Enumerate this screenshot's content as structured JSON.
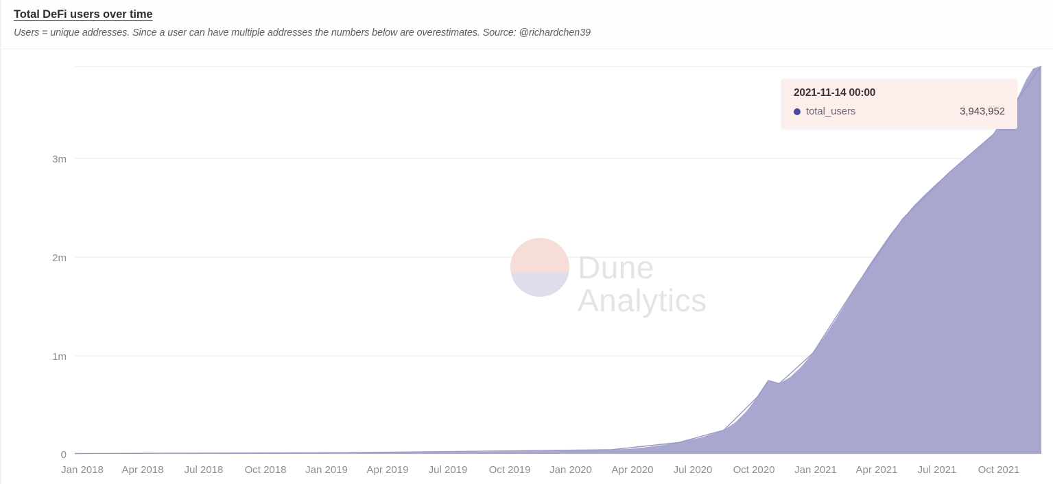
{
  "header": {
    "title": "Total DeFi users over time",
    "subtitle": "Users = unique addresses. Since a user can have multiple addresses the numbers below are overestimates. Source: @richardchen39"
  },
  "tooltip": {
    "date": "2021-11-14 00:00",
    "series_name": "total_users",
    "value": "3,943,952",
    "dot_color": "#4b4b9e",
    "background": "#fbeeeb"
  },
  "watermark": {
    "line1": "Dune",
    "line2": "Analytics"
  },
  "chart_data": {
    "type": "area",
    "title": "Total DeFi users over time",
    "subtitle": "Users = unique addresses. Since a user can have multiple addresses the numbers below are overestimates. Source: @richardchen39",
    "xlabel": "",
    "ylabel": "",
    "series_name": "total_users",
    "fill_color": "#a8a7cf",
    "grid": true,
    "legend": "none",
    "ylim": [
      0,
      4200000
    ],
    "ytick_labels": [
      "0",
      "1m",
      "2m",
      "3m"
    ],
    "ytick_values": [
      0,
      1000000,
      2000000,
      3000000
    ],
    "xtick_labels": [
      "Jan 2018",
      "Apr 2018",
      "Jul 2018",
      "Oct 2018",
      "Jan 2019",
      "Apr 2019",
      "Jul 2019",
      "Oct 2019",
      "Jan 2020",
      "Apr 2020",
      "Jul 2020",
      "Oct 2020",
      "Jan 2021",
      "Apr 2021",
      "Jul 2021",
      "Oct 2021"
    ],
    "x": [
      "2018-01",
      "2018-04",
      "2018-07",
      "2018-10",
      "2019-01",
      "2019-04",
      "2019-07",
      "2019-10",
      "2020-01",
      "2020-02",
      "2020-04",
      "2020-06",
      "2020-07",
      "2020-08",
      "2020-09",
      "2020-10",
      "2020-11",
      "2020-12",
      "2021-01",
      "2021-02",
      "2021-03",
      "2021-04",
      "2021-05",
      "2021-06",
      "2021-07",
      "2021-08",
      "2021-09",
      "2021-10",
      "2021-11-14"
    ],
    "values": [
      2000,
      5000,
      9000,
      14000,
      20000,
      28000,
      38000,
      52000,
      70000,
      82000,
      105000,
      140000,
      175000,
      240000,
      330000,
      470000,
      640000,
      800000,
      980000,
      1080000,
      1250000,
      1520000,
      1900000,
      2200000,
      2520000,
      2900000,
      3250000,
      3600000,
      3943952
    ]
  }
}
